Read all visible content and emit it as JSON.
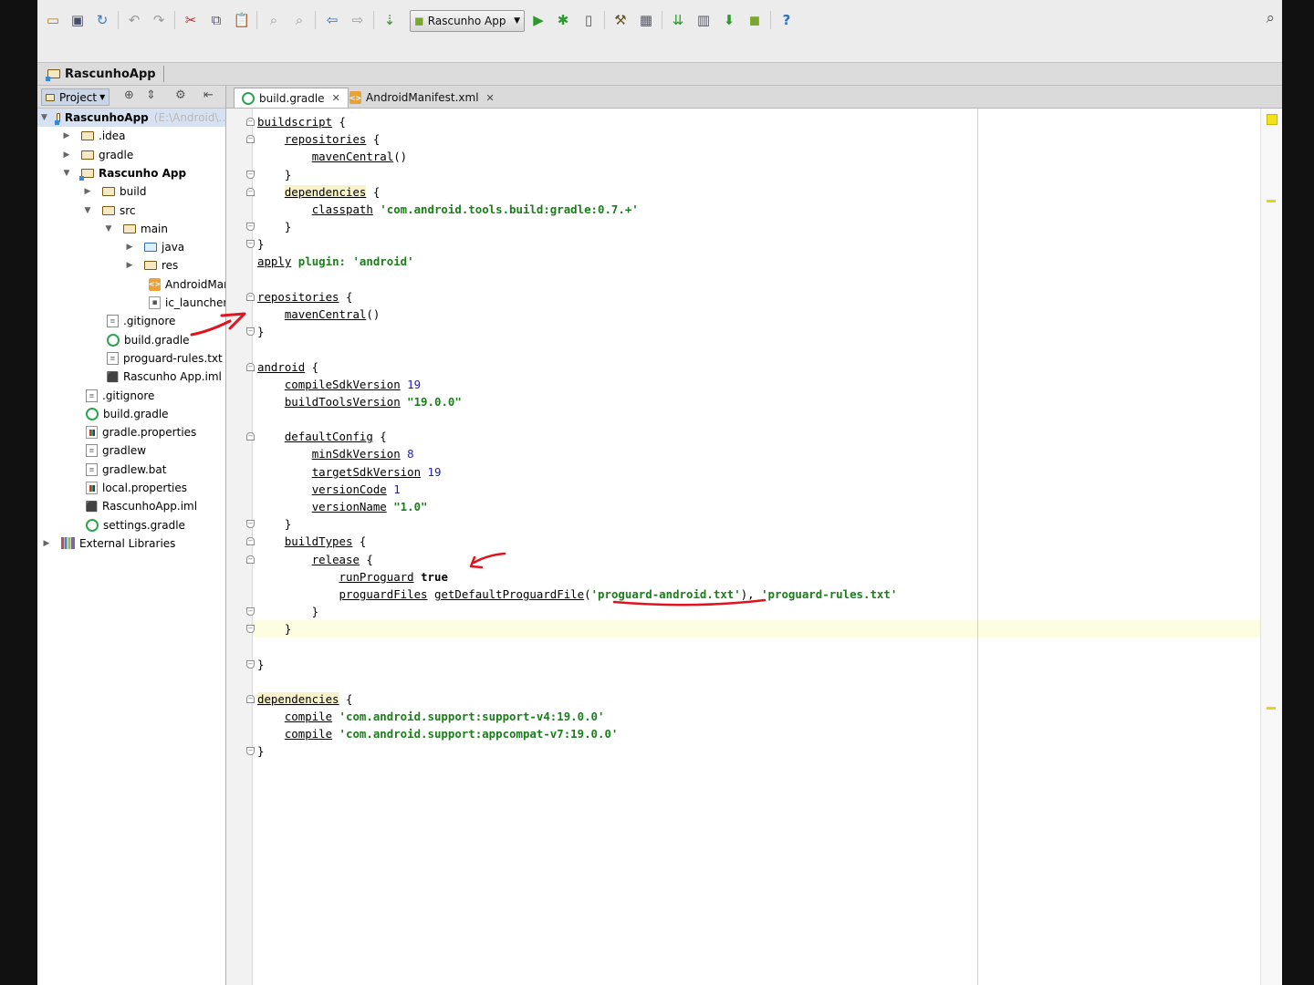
{
  "run_config": "Rascunho App",
  "breadcrumb": "RascunhoApp",
  "panel": {
    "view_mode": "Project"
  },
  "tree": [
    {
      "label": "RascunhoApp",
      "hint": "(E:\\Android\\...",
      "icon": "folder-module",
      "toggle": "▼",
      "bold": true
    },
    {
      "label": ".idea",
      "icon": "folder",
      "toggle": "▶"
    },
    {
      "label": "gradle",
      "icon": "folder",
      "toggle": "▶"
    },
    {
      "label": "Rascunho App",
      "icon": "folder-module",
      "toggle": "▼",
      "bold": true
    },
    {
      "label": "build",
      "icon": "folder",
      "toggle": "▶"
    },
    {
      "label": "src",
      "icon": "folder",
      "toggle": "▼"
    },
    {
      "label": "main",
      "icon": "folder",
      "toggle": "▼"
    },
    {
      "label": "java",
      "icon": "folder-source",
      "toggle": "▶"
    },
    {
      "label": "res",
      "icon": "folder-resources",
      "toggle": "▶"
    },
    {
      "label": "AndroidManifest.xml",
      "icon": "xml-icon",
      "toggle": ""
    },
    {
      "label": "ic_launcher-web.png",
      "icon": "image-icon",
      "toggle": ""
    },
    {
      "label": ".gitignore",
      "icon": "text-file-icon",
      "toggle": ""
    },
    {
      "label": "build.gradle",
      "icon": "gradle-icon",
      "toggle": ""
    },
    {
      "label": "proguard-rules.txt",
      "icon": "text-file-icon",
      "toggle": ""
    },
    {
      "label": "Rascunho App.iml",
      "icon": "iml-icon",
      "toggle": ""
    },
    {
      "label": ".gitignore",
      "icon": "text-file-icon",
      "toggle": ""
    },
    {
      "label": "build.gradle",
      "icon": "gradle-icon",
      "toggle": ""
    },
    {
      "label": "gradle.properties",
      "icon": "properties-icon",
      "toggle": ""
    },
    {
      "label": "gradlew",
      "icon": "text-file-icon",
      "toggle": ""
    },
    {
      "label": "gradlew.bat",
      "icon": "text-file-icon",
      "toggle": ""
    },
    {
      "label": "local.properties",
      "icon": "properties-icon",
      "toggle": ""
    },
    {
      "label": "RascunhoApp.iml",
      "icon": "iml-icon",
      "toggle": ""
    },
    {
      "label": "settings.gradle",
      "icon": "gradle-icon",
      "toggle": ""
    },
    {
      "label": "External Libraries",
      "icon": "libraries-icon",
      "toggle": "▶"
    }
  ],
  "tabs": [
    {
      "label": "build.gradle",
      "icon": "gradle-icon",
      "active": true
    },
    {
      "label": "AndroidManifest.xml",
      "icon": "xml-icon",
      "active": false
    }
  ],
  "code": [
    [
      {
        "t": "buildscript",
        "u": 1
      },
      {
        "t": " {"
      }
    ],
    [
      {
        "t": "    "
      },
      {
        "t": "repositories",
        "u": 1
      },
      {
        "t": " {"
      }
    ],
    [
      {
        "t": "        "
      },
      {
        "t": "mavenCentral",
        "u": 1
      },
      {
        "t": "()"
      }
    ],
    [
      {
        "t": "    }"
      }
    ],
    [
      {
        "t": "    "
      },
      {
        "t": "dependencies",
        "u": 1,
        "h": 1
      },
      {
        "t": " {"
      }
    ],
    [
      {
        "t": "        "
      },
      {
        "t": "classpath",
        "u": 1
      },
      {
        "t": " "
      },
      {
        "t": "'com.android.tools.build:gradle:0.7.+'",
        "s": 1
      }
    ],
    [
      {
        "t": "    }"
      }
    ],
    [
      {
        "t": "}"
      }
    ],
    [
      {
        "t": "apply",
        "u": 1
      },
      {
        "t": " "
      },
      {
        "t": "plugin:",
        "s": 1
      },
      {
        "t": " "
      },
      {
        "t": "'android'",
        "s": 1
      }
    ],
    [
      {
        "t": ""
      }
    ],
    [
      {
        "t": "repositories",
        "u": 1
      },
      {
        "t": " {"
      }
    ],
    [
      {
        "t": "    "
      },
      {
        "t": "mavenCentral",
        "u": 1
      },
      {
        "t": "()"
      }
    ],
    [
      {
        "t": "}"
      }
    ],
    [
      {
        "t": ""
      }
    ],
    [
      {
        "t": "android",
        "u": 1
      },
      {
        "t": " {"
      }
    ],
    [
      {
        "t": "    "
      },
      {
        "t": "compileSdkVersion",
        "u": 1
      },
      {
        "t": " "
      },
      {
        "t": "19",
        "n": 1
      }
    ],
    [
      {
        "t": "    "
      },
      {
        "t": "buildToolsVersion",
        "u": 1
      },
      {
        "t": " "
      },
      {
        "t": "\"19.0.0\"",
        "s": 1
      }
    ],
    [
      {
        "t": ""
      }
    ],
    [
      {
        "t": "    "
      },
      {
        "t": "defaultConfig",
        "u": 1
      },
      {
        "t": " {"
      }
    ],
    [
      {
        "t": "        "
      },
      {
        "t": "minSdkVersion",
        "u": 1
      },
      {
        "t": " "
      },
      {
        "t": "8",
        "n": 1
      }
    ],
    [
      {
        "t": "        "
      },
      {
        "t": "targetSdkVersion",
        "u": 1
      },
      {
        "t": " "
      },
      {
        "t": "19",
        "n": 1
      }
    ],
    [
      {
        "t": "        "
      },
      {
        "t": "versionCode",
        "u": 1
      },
      {
        "t": " "
      },
      {
        "t": "1",
        "n": 1
      }
    ],
    [
      {
        "t": "        "
      },
      {
        "t": "versionName",
        "u": 1
      },
      {
        "t": " "
      },
      {
        "t": "\"1.0\"",
        "s": 1
      }
    ],
    [
      {
        "t": "    }"
      }
    ],
    [
      {
        "t": "    "
      },
      {
        "t": "buildTypes",
        "u": 1
      },
      {
        "t": " {"
      }
    ],
    [
      {
        "t": "        "
      },
      {
        "t": "release",
        "u": 1
      },
      {
        "t": " {"
      }
    ],
    [
      {
        "t": "            "
      },
      {
        "t": "runProguard",
        "u": 1
      },
      {
        "t": " "
      },
      {
        "t": "true",
        "k": 1
      }
    ],
    [
      {
        "t": "            "
      },
      {
        "t": "proguardFiles",
        "u": 1
      },
      {
        "t": " "
      },
      {
        "t": "getDefaultProguardFile",
        "u": 1
      },
      {
        "t": "("
      },
      {
        "t": "'proguard-android.txt'",
        "s": 1
      },
      {
        "t": "), "
      },
      {
        "t": "'proguard-rules.txt'",
        "s": 1
      }
    ],
    [
      {
        "t": "        }"
      }
    ],
    [
      {
        "t": "    }"
      }
    ],
    [
      {
        "t": ""
      }
    ],
    [
      {
        "t": "}"
      }
    ],
    [
      {
        "t": ""
      }
    ],
    [
      {
        "t": "dependencies",
        "u": 1,
        "h": 1
      },
      {
        "t": " {"
      }
    ],
    [
      {
        "t": "    "
      },
      {
        "t": "compile",
        "u": 1
      },
      {
        "t": " "
      },
      {
        "t": "'com.android.support:support-v4:19.0.0'",
        "s": 1
      }
    ],
    [
      {
        "t": "    "
      },
      {
        "t": "compile",
        "u": 1
      },
      {
        "t": " "
      },
      {
        "t": "'com.android.support:appcompat-v7:19.0.0'",
        "s": 1
      }
    ],
    [
      {
        "t": "}"
      }
    ]
  ],
  "colors": {
    "string": "#1a7f1a",
    "number": "#1a1ad0",
    "annotation": "#e0141e"
  }
}
